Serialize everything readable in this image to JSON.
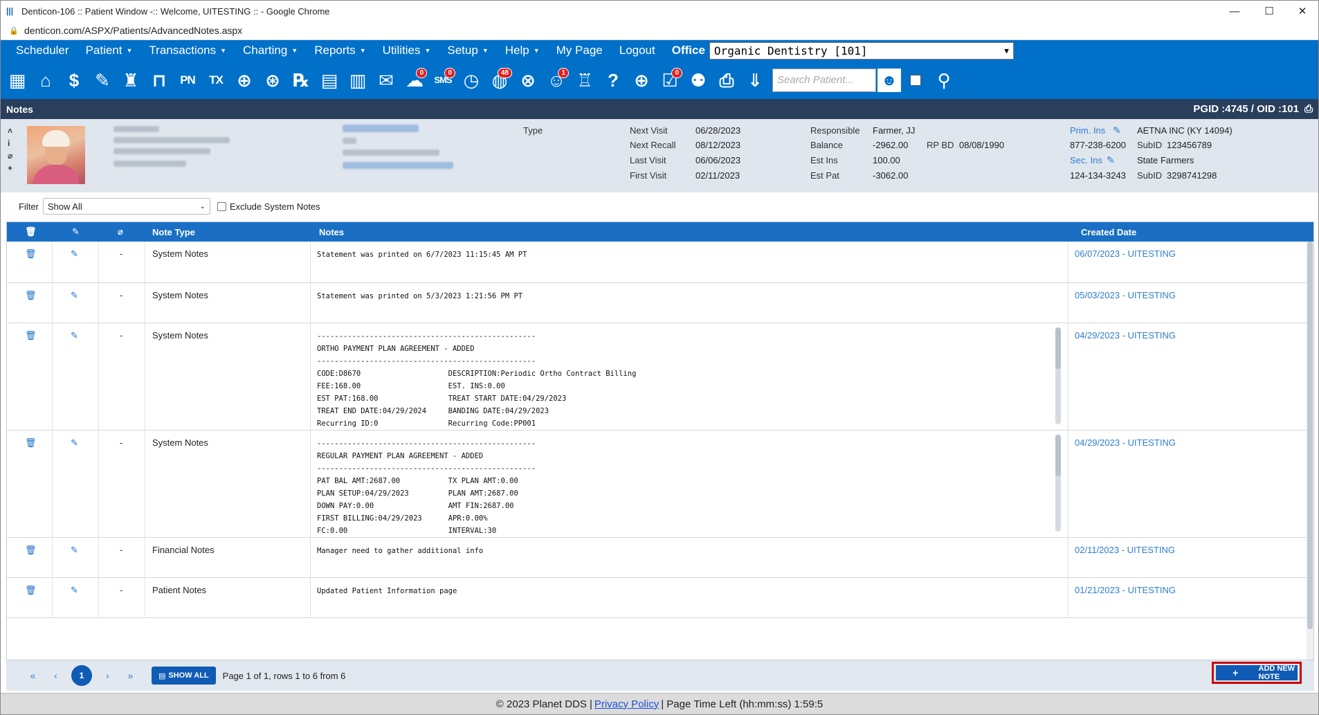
{
  "window": {
    "title": "Denticon-106 :: Patient Window -:: Welcome, UITESTING :: - Google Chrome",
    "min": "—",
    "max": "☐",
    "close": "✕"
  },
  "browser": {
    "url": "denticon.com/ASPX/Patients/AdvancedNotes.aspx"
  },
  "menu": {
    "items": [
      {
        "label": "Scheduler",
        "caret": false
      },
      {
        "label": "Patient",
        "caret": true
      },
      {
        "label": "Transactions",
        "caret": true
      },
      {
        "label": "Charting",
        "caret": true
      },
      {
        "label": "Reports",
        "caret": true
      },
      {
        "label": "Utilities",
        "caret": true
      },
      {
        "label": "Setup",
        "caret": true
      },
      {
        "label": "Help",
        "caret": true
      },
      {
        "label": "My Page",
        "caret": false
      },
      {
        "label": "Logout",
        "caret": false
      }
    ],
    "office_label": "Office",
    "office_value": "Organic Dentistry [101]"
  },
  "toolbar": {
    "pn": "PN",
    "tx": "TX",
    "rx": "℞",
    "sms_badge": "0",
    "globe_badge": "48",
    "support_badge": "1",
    "checklist_badge": "0",
    "search_placeholder": "Search Patient..."
  },
  "section": {
    "title": "Notes",
    "ids": "PGID :4745  /  OID :101"
  },
  "patient": {
    "type_label": "Type",
    "next_visit_label": "Next Visit",
    "next_visit": "06/28/2023",
    "next_recall_label": "Next Recall",
    "next_recall": "08/12/2023",
    "last_visit_label": "Last Visit",
    "last_visit": "06/06/2023",
    "first_visit_label": "First Visit",
    "first_visit": "02/11/2023",
    "responsible_label": "Responsible",
    "responsible": "Farmer, JJ",
    "balance_label": "Balance",
    "balance": "-2962.00",
    "rpbd_label": "RP BD",
    "rpbd": "08/08/1990",
    "est_ins_label": "Est Ins",
    "est_ins": "100.00",
    "est_pat_label": "Est Pat",
    "est_pat": "-3062.00",
    "prim_ins_label": "Prim. Ins",
    "prim_ins": "AETNA INC (KY 14094)",
    "prim_phone": "877-238-6200",
    "prim_subid_label": "SubID",
    "prim_subid": "123456789",
    "sec_ins_label": "Sec. Ins",
    "sec_ins": "State Farmers",
    "sec_phone": "124-134-3243",
    "sec_subid_label": "SubID",
    "sec_subid": "3298741298"
  },
  "filter": {
    "label": "Filter",
    "value": "Show All",
    "exclude_label": "Exclude System Notes"
  },
  "grid": {
    "headers": {
      "note_type": "Note Type",
      "notes": "Notes",
      "created": "Created Date"
    },
    "rows": [
      {
        "type": "System Notes",
        "note": "Statement was printed on 6/7/2023 11:15:45 AM PT",
        "created": "06/07/2023 - UITESTING",
        "dash": "-"
      },
      {
        "type": "System Notes",
        "note": "Statement was printed on 5/3/2023 1:21:56 PM PT",
        "created": "05/03/2023 - UITESTING",
        "dash": "-"
      },
      {
        "type": "System Notes",
        "note": "--------------------------------------------------\nORTHO PAYMENT PLAN AGREEMENT - ADDED\n--------------------------------------------------\nCODE:D8670                    DESCRIPTION:Periodic Ortho Contract Billing\nFEE:168.00                    EST. INS:0.00\nEST PAT:168.00                TREAT START DATE:04/29/2023\nTREAT END DATE:04/29/2024     BANDING DATE:04/29/2023\nRecurring ID:0                Recurring Code:PP001",
        "created": "04/29/2023 - UITESTING",
        "dash": "-"
      },
      {
        "type": "System Notes",
        "note": "--------------------------------------------------\nREGULAR PAYMENT PLAN AGREEMENT - ADDED\n--------------------------------------------------\nPAT BAL AMT:2687.00           TX PLAN AMT:0.00\nPLAN SETUP:04/29/2023         PLAN AMT:2687.00\nDOWN PAY:0.00                 AMT FIN:2687.00\nFIRST BILLING:04/29/2023      APR:0.00%\nFC:0.00                       INTERVAL:30",
        "created": "04/29/2023 - UITESTING",
        "dash": "-"
      },
      {
        "type": "Financial Notes",
        "note": "Manager need to gather additional info",
        "created": "02/11/2023 - UITESTING",
        "dash": "-"
      },
      {
        "type": "Patient Notes",
        "note": "Updated Patient Information page",
        "created": "01/21/2023 - UITESTING",
        "dash": "-"
      }
    ]
  },
  "pager": {
    "first": "«",
    "prev": "‹",
    "page": "1",
    "next": "›",
    "last": "»",
    "show_all": "SHOW ALL",
    "info": "Page 1 of 1, rows 1 to 6 from 6",
    "add_note": "ADD NEW NOTE"
  },
  "footer": {
    "copyright": "© 2023 Planet DDS",
    "sep": "|",
    "privacy": "Privacy Policy",
    "time_left": "| Page Time Left (hh:mm:ss) 1:59:5"
  }
}
